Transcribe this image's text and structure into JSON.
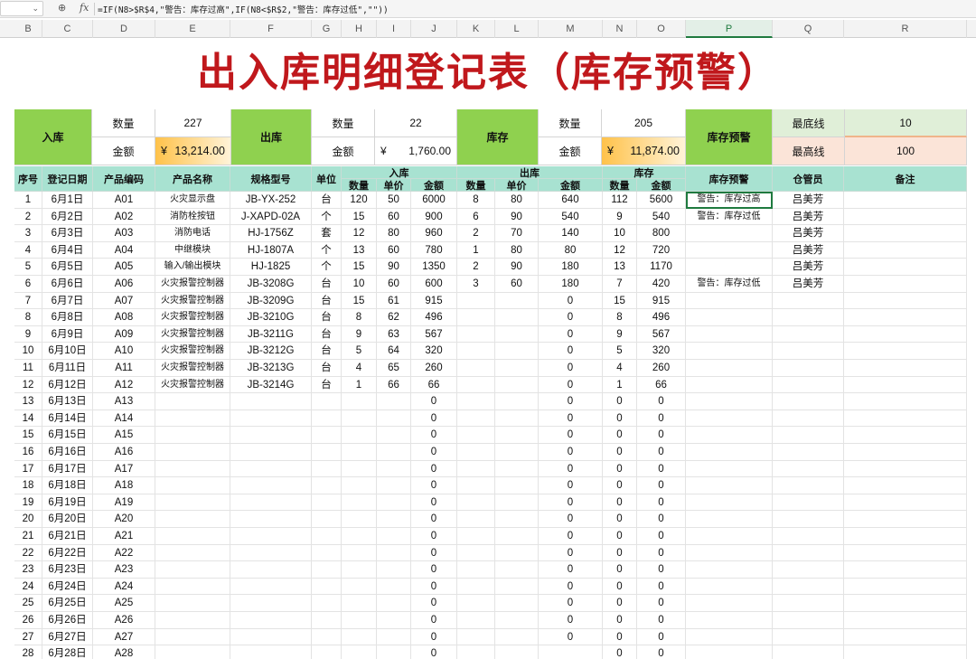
{
  "formula_bar": {
    "zoom_icon": "zoom-icon",
    "fx_label": "fx",
    "formula": "=IF(N8>$R$4,\"警告：库存过高\",IF(N8<$R$2,\"警告：库存过低\",\"\"))"
  },
  "columns": [
    "B",
    "C",
    "D",
    "E",
    "F",
    "G",
    "H",
    "I",
    "J",
    "K",
    "L",
    "M",
    "N",
    "O",
    "P",
    "Q",
    "R"
  ],
  "selected_column": "P",
  "title": "出入库明细登记表（库存预警）",
  "summary": {
    "in": {
      "label": "入库",
      "qty_label": "数量",
      "qty": "227",
      "amt_label": "金额",
      "currency": "¥",
      "amt": "13,214.00"
    },
    "out": {
      "label": "出库",
      "qty_label": "数量",
      "qty": "22",
      "amt_label": "金额",
      "currency": "¥",
      "amt": "1,760.00"
    },
    "stock": {
      "label": "库存",
      "qty_label": "数量",
      "qty": "205",
      "amt_label": "金额",
      "currency": "¥",
      "amt": "11,874.00"
    },
    "alert": {
      "label": "库存预警"
    },
    "min": {
      "label": "最底线",
      "value": "10"
    },
    "max": {
      "label": "最高线",
      "value": "100"
    }
  },
  "headers": {
    "seq": "序号",
    "date": "登记日期",
    "code": "产品编码",
    "name": "产品名称",
    "spec": "规格型号",
    "unit": "单位",
    "in": "入库",
    "out": "出库",
    "stock": "库存",
    "qty": "数量",
    "price": "单价",
    "amount": "金额",
    "warn": "库存预警",
    "keeper": "仓管员",
    "note": "备注"
  },
  "rows": [
    {
      "seq": "1",
      "date": "6月1日",
      "code": "A01",
      "name": "火灾显示盘",
      "spec": "JB-YX-252",
      "unit": "台",
      "iq": "120",
      "ip": "50",
      "ia": "6000",
      "oq": "8",
      "op": "80",
      "oa": "640",
      "sq": "112",
      "sa": "5600",
      "warn": "警告：库存过高",
      "keeper": "吕美芳"
    },
    {
      "seq": "2",
      "date": "6月2日",
      "code": "A02",
      "name": "消防栓按钮",
      "spec": "J-XAPD-02A",
      "unit": "个",
      "iq": "15",
      "ip": "60",
      "ia": "900",
      "oq": "6",
      "op": "90",
      "oa": "540",
      "sq": "9",
      "sa": "540",
      "warn": "警告：库存过低",
      "keeper": "吕美芳"
    },
    {
      "seq": "3",
      "date": "6月3日",
      "code": "A03",
      "name": "消防电话",
      "spec": "HJ-1756Z",
      "unit": "套",
      "iq": "12",
      "ip": "80",
      "ia": "960",
      "oq": "2",
      "op": "70",
      "oa": "140",
      "sq": "10",
      "sa": "800",
      "warn": "",
      "keeper": "吕美芳"
    },
    {
      "seq": "4",
      "date": "6月4日",
      "code": "A04",
      "name": "中继模块",
      "spec": "HJ-1807A",
      "unit": "个",
      "iq": "13",
      "ip": "60",
      "ia": "780",
      "oq": "1",
      "op": "80",
      "oa": "80",
      "sq": "12",
      "sa": "720",
      "warn": "",
      "keeper": "吕美芳"
    },
    {
      "seq": "5",
      "date": "6月5日",
      "code": "A05",
      "name": "输入/输出模块",
      "spec": "HJ-1825",
      "unit": "个",
      "iq": "15",
      "ip": "90",
      "ia": "1350",
      "oq": "2",
      "op": "90",
      "oa": "180",
      "sq": "13",
      "sa": "1170",
      "warn": "",
      "keeper": "吕美芳"
    },
    {
      "seq": "6",
      "date": "6月6日",
      "code": "A06",
      "name": "火灾报警控制器",
      "spec": "JB-3208G",
      "unit": "台",
      "iq": "10",
      "ip": "60",
      "ia": "600",
      "oq": "3",
      "op": "60",
      "oa": "180",
      "sq": "7",
      "sa": "420",
      "warn": "警告：库存过低",
      "keeper": "吕美芳"
    },
    {
      "seq": "7",
      "date": "6月7日",
      "code": "A07",
      "name": "火灾报警控制器",
      "spec": "JB-3209G",
      "unit": "台",
      "iq": "15",
      "ip": "61",
      "ia": "915",
      "oq": "",
      "op": "",
      "oa": "0",
      "sq": "15",
      "sa": "915",
      "warn": "",
      "keeper": ""
    },
    {
      "seq": "8",
      "date": "6月8日",
      "code": "A08",
      "name": "火灾报警控制器",
      "spec": "JB-3210G",
      "unit": "台",
      "iq": "8",
      "ip": "62",
      "ia": "496",
      "oq": "",
      "op": "",
      "oa": "0",
      "sq": "8",
      "sa": "496",
      "warn": "",
      "keeper": ""
    },
    {
      "seq": "9",
      "date": "6月9日",
      "code": "A09",
      "name": "火灾报警控制器",
      "spec": "JB-3211G",
      "unit": "台",
      "iq": "9",
      "ip": "63",
      "ia": "567",
      "oq": "",
      "op": "",
      "oa": "0",
      "sq": "9",
      "sa": "567",
      "warn": "",
      "keeper": ""
    },
    {
      "seq": "10",
      "date": "6月10日",
      "code": "A10",
      "name": "火灾报警控制器",
      "spec": "JB-3212G",
      "unit": "台",
      "iq": "5",
      "ip": "64",
      "ia": "320",
      "oq": "",
      "op": "",
      "oa": "0",
      "sq": "5",
      "sa": "320",
      "warn": "",
      "keeper": ""
    },
    {
      "seq": "11",
      "date": "6月11日",
      "code": "A11",
      "name": "火灾报警控制器",
      "spec": "JB-3213G",
      "unit": "台",
      "iq": "4",
      "ip": "65",
      "ia": "260",
      "oq": "",
      "op": "",
      "oa": "0",
      "sq": "4",
      "sa": "260",
      "warn": "",
      "keeper": ""
    },
    {
      "seq": "12",
      "date": "6月12日",
      "code": "A12",
      "name": "火灾报警控制器",
      "spec": "JB-3214G",
      "unit": "台",
      "iq": "1",
      "ip": "66",
      "ia": "66",
      "oq": "",
      "op": "",
      "oa": "0",
      "sq": "1",
      "sa": "66",
      "warn": "",
      "keeper": ""
    },
    {
      "seq": "13",
      "date": "6月13日",
      "code": "A13",
      "name": "",
      "spec": "",
      "unit": "",
      "iq": "",
      "ip": "",
      "ia": "0",
      "oq": "",
      "op": "",
      "oa": "0",
      "sq": "0",
      "sa": "0",
      "warn": "",
      "keeper": ""
    },
    {
      "seq": "14",
      "date": "6月14日",
      "code": "A14",
      "name": "",
      "spec": "",
      "unit": "",
      "iq": "",
      "ip": "",
      "ia": "0",
      "oq": "",
      "op": "",
      "oa": "0",
      "sq": "0",
      "sa": "0",
      "warn": "",
      "keeper": ""
    },
    {
      "seq": "15",
      "date": "6月15日",
      "code": "A15",
      "name": "",
      "spec": "",
      "unit": "",
      "iq": "",
      "ip": "",
      "ia": "0",
      "oq": "",
      "op": "",
      "oa": "0",
      "sq": "0",
      "sa": "0",
      "warn": "",
      "keeper": ""
    },
    {
      "seq": "16",
      "date": "6月16日",
      "code": "A16",
      "name": "",
      "spec": "",
      "unit": "",
      "iq": "",
      "ip": "",
      "ia": "0",
      "oq": "",
      "op": "",
      "oa": "0",
      "sq": "0",
      "sa": "0",
      "warn": "",
      "keeper": ""
    },
    {
      "seq": "17",
      "date": "6月17日",
      "code": "A17",
      "name": "",
      "spec": "",
      "unit": "",
      "iq": "",
      "ip": "",
      "ia": "0",
      "oq": "",
      "op": "",
      "oa": "0",
      "sq": "0",
      "sa": "0",
      "warn": "",
      "keeper": ""
    },
    {
      "seq": "18",
      "date": "6月18日",
      "code": "A18",
      "name": "",
      "spec": "",
      "unit": "",
      "iq": "",
      "ip": "",
      "ia": "0",
      "oq": "",
      "op": "",
      "oa": "0",
      "sq": "0",
      "sa": "0",
      "warn": "",
      "keeper": ""
    },
    {
      "seq": "19",
      "date": "6月19日",
      "code": "A19",
      "name": "",
      "spec": "",
      "unit": "",
      "iq": "",
      "ip": "",
      "ia": "0",
      "oq": "",
      "op": "",
      "oa": "0",
      "sq": "0",
      "sa": "0",
      "warn": "",
      "keeper": ""
    },
    {
      "seq": "20",
      "date": "6月20日",
      "code": "A20",
      "name": "",
      "spec": "",
      "unit": "",
      "iq": "",
      "ip": "",
      "ia": "0",
      "oq": "",
      "op": "",
      "oa": "0",
      "sq": "0",
      "sa": "0",
      "warn": "",
      "keeper": ""
    },
    {
      "seq": "21",
      "date": "6月21日",
      "code": "A21",
      "name": "",
      "spec": "",
      "unit": "",
      "iq": "",
      "ip": "",
      "ia": "0",
      "oq": "",
      "op": "",
      "oa": "0",
      "sq": "0",
      "sa": "0",
      "warn": "",
      "keeper": ""
    },
    {
      "seq": "22",
      "date": "6月22日",
      "code": "A22",
      "name": "",
      "spec": "",
      "unit": "",
      "iq": "",
      "ip": "",
      "ia": "0",
      "oq": "",
      "op": "",
      "oa": "0",
      "sq": "0",
      "sa": "0",
      "warn": "",
      "keeper": ""
    },
    {
      "seq": "23",
      "date": "6月23日",
      "code": "A23",
      "name": "",
      "spec": "",
      "unit": "",
      "iq": "",
      "ip": "",
      "ia": "0",
      "oq": "",
      "op": "",
      "oa": "0",
      "sq": "0",
      "sa": "0",
      "warn": "",
      "keeper": ""
    },
    {
      "seq": "24",
      "date": "6月24日",
      "code": "A24",
      "name": "",
      "spec": "",
      "unit": "",
      "iq": "",
      "ip": "",
      "ia": "0",
      "oq": "",
      "op": "",
      "oa": "0",
      "sq": "0",
      "sa": "0",
      "warn": "",
      "keeper": ""
    },
    {
      "seq": "25",
      "date": "6月25日",
      "code": "A25",
      "name": "",
      "spec": "",
      "unit": "",
      "iq": "",
      "ip": "",
      "ia": "0",
      "oq": "",
      "op": "",
      "oa": "0",
      "sq": "0",
      "sa": "0",
      "warn": "",
      "keeper": ""
    },
    {
      "seq": "26",
      "date": "6月26日",
      "code": "A26",
      "name": "",
      "spec": "",
      "unit": "",
      "iq": "",
      "ip": "",
      "ia": "0",
      "oq": "",
      "op": "",
      "oa": "0",
      "sq": "0",
      "sa": "0",
      "warn": "",
      "keeper": ""
    },
    {
      "seq": "27",
      "date": "6月27日",
      "code": "A27",
      "name": "",
      "spec": "",
      "unit": "",
      "iq": "",
      "ip": "",
      "ia": "0",
      "oq": "",
      "op": "",
      "oa": "0",
      "sq": "0",
      "sa": "0",
      "warn": "",
      "keeper": ""
    },
    {
      "seq": "28",
      "date": "6月28日",
      "code": "A28",
      "name": "",
      "spec": "",
      "unit": "",
      "iq": "",
      "ip": "",
      "ia": "0",
      "oq": "",
      "op": "",
      "oa": "",
      "sq": "0",
      "sa": "0",
      "warn": "",
      "keeper": ""
    }
  ],
  "active_cell": {
    "row": 0,
    "field": "warn"
  }
}
